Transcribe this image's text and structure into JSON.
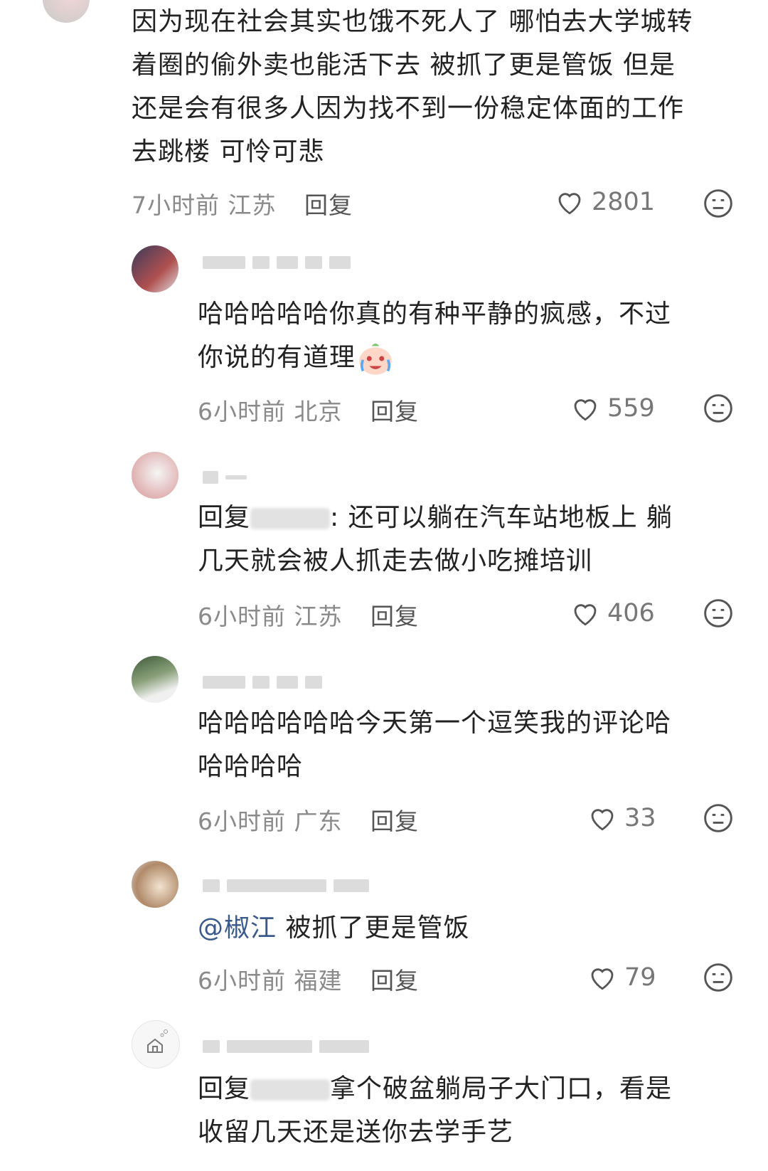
{
  "comments": [
    {
      "lines": [
        "因为现在社会其实也饿不死人了 哪怕去大学城转",
        "着圈的偷外卖也能活下去 被抓了更是管饭 但是",
        "还是会有很多人因为找不到一份稳定体面的工作",
        "去跳楼 可怜可悲"
      ],
      "time": "7小时前",
      "location": "江苏",
      "reply": "回复",
      "likes": "2801"
    },
    {
      "lines": [
        "哈哈哈哈哈你真的有种平静的疯感，不过",
        "你说的有道理"
      ],
      "time": "6小时前",
      "location": "北京",
      "reply": "回复",
      "likes": "559"
    },
    {
      "reply_prefix": "回复",
      "line1_rest": ": 还可以躺在汽车站地板上 躺",
      "line2": "几天就会被人抓走去做小吃摊培训",
      "time": "6小时前",
      "location": "江苏",
      "reply": "回复",
      "likes": "406"
    },
    {
      "lines": [
        "哈哈哈哈哈哈今天第一个逗笑我的评论哈",
        "哈哈哈哈"
      ],
      "time": "6小时前",
      "location": "广东",
      "reply": "回复",
      "likes": "33"
    },
    {
      "mention": "@椒江",
      "rest": " 被抓了更是管饭",
      "time": "6小时前",
      "location": "福建",
      "reply": "回复",
      "likes": "79"
    },
    {
      "reply_prefix": "回复",
      "line1_rest": "拿个破盆躺局子大门口，看是",
      "line2": "收留几天还是送你去学手艺"
    }
  ],
  "icons": {
    "like": "heart-outline-icon",
    "dislike": "meh-face-icon"
  },
  "colors": {
    "mention": "#3a5a8c",
    "meta": "#8a8a8a",
    "text": "#222222"
  }
}
